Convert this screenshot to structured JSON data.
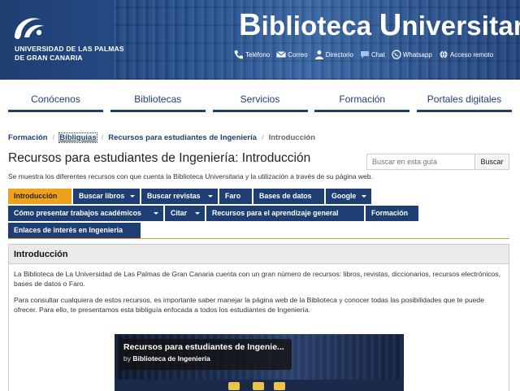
{
  "header": {
    "university_name_line1": "UNIVERSIDAD DE LAS PALMAS",
    "university_name_line2": "DE GRAN CANARIA",
    "title_cap1": "B",
    "title_rest1": "iblioteca ",
    "title_cap2": "U",
    "title_rest2": "niversitaria",
    "contacts": [
      {
        "label": "Teléfono",
        "icon": "phone-icon"
      },
      {
        "label": "Correo",
        "icon": "mail-icon"
      },
      {
        "label": "Directorio",
        "icon": "person-icon"
      },
      {
        "label": "Chat",
        "icon": "chat-icon"
      },
      {
        "label": "Whatsapp",
        "icon": "whatsapp-icon"
      },
      {
        "label": "Acceso remoto",
        "icon": "globe-icon"
      }
    ]
  },
  "mainnav": {
    "items": [
      "Conócenos",
      "Bibliotecas",
      "Servicios",
      "Formación",
      "Portales digitales"
    ]
  },
  "breadcrumb": {
    "items": [
      "Formación",
      "Bibliguías",
      "Recursos para estudiantes de Ingeniería",
      "Introducción"
    ],
    "separator": "/"
  },
  "page": {
    "title": "Recursos para estudiantes de Ingeniería: Introducción",
    "search_placeholder": "Buscar en esta guía",
    "search_button": "Buscar",
    "description": "Se muestra los diferentes recursos con que cuenta la Biblioteca Universitaria y la utilización a través de su página web."
  },
  "tabs": [
    {
      "label": "Introducción",
      "active": true,
      "dropdown": false
    },
    {
      "label": "Buscar libros",
      "active": false,
      "dropdown": true
    },
    {
      "label": "Buscar revistas",
      "active": false,
      "dropdown": true
    },
    {
      "label": "Faro",
      "active": false,
      "dropdown": false
    },
    {
      "label": "Bases de datos",
      "active": false,
      "dropdown": false
    },
    {
      "label": "Google",
      "active": false,
      "dropdown": true
    },
    {
      "label": "Cómo presentar trabajos académicos",
      "active": false,
      "dropdown": true
    },
    {
      "label": "Citar",
      "active": false,
      "dropdown": true
    },
    {
      "label": "Recursos para el aprendizaje general",
      "active": false,
      "dropdown": false
    },
    {
      "label": "Formación",
      "active": false,
      "dropdown": false
    },
    {
      "label": "Enlaces de interés en Ingeniería",
      "active": false,
      "dropdown": false
    }
  ],
  "content": {
    "heading": "Introducción",
    "paragraph1": "La Biblioteca de La  Universidad de Las Palmas de Gran Canaria cuenta con un gran número de recursos: libros, revistas, diccionarios, recursos electrónicos, bases de datos o Faro.",
    "paragraph2": "Para consultar cualquiera de estos recursos, es importante saber manejar la página web de la Biblioteca y conocer todas las posibilidades que te puede ofrecer. Para ello, te presentamos esta bibliguía enfocada a todos los estudiantes de Ingeniería.",
    "video": {
      "title": "Recursos para estudiantes de Ingenie...",
      "by_prefix": "by",
      "author": "Biblioteca  de Ingeniería"
    }
  },
  "colors": {
    "brand_blue": "#1f3f74",
    "active_tab": "#f0a11a"
  }
}
